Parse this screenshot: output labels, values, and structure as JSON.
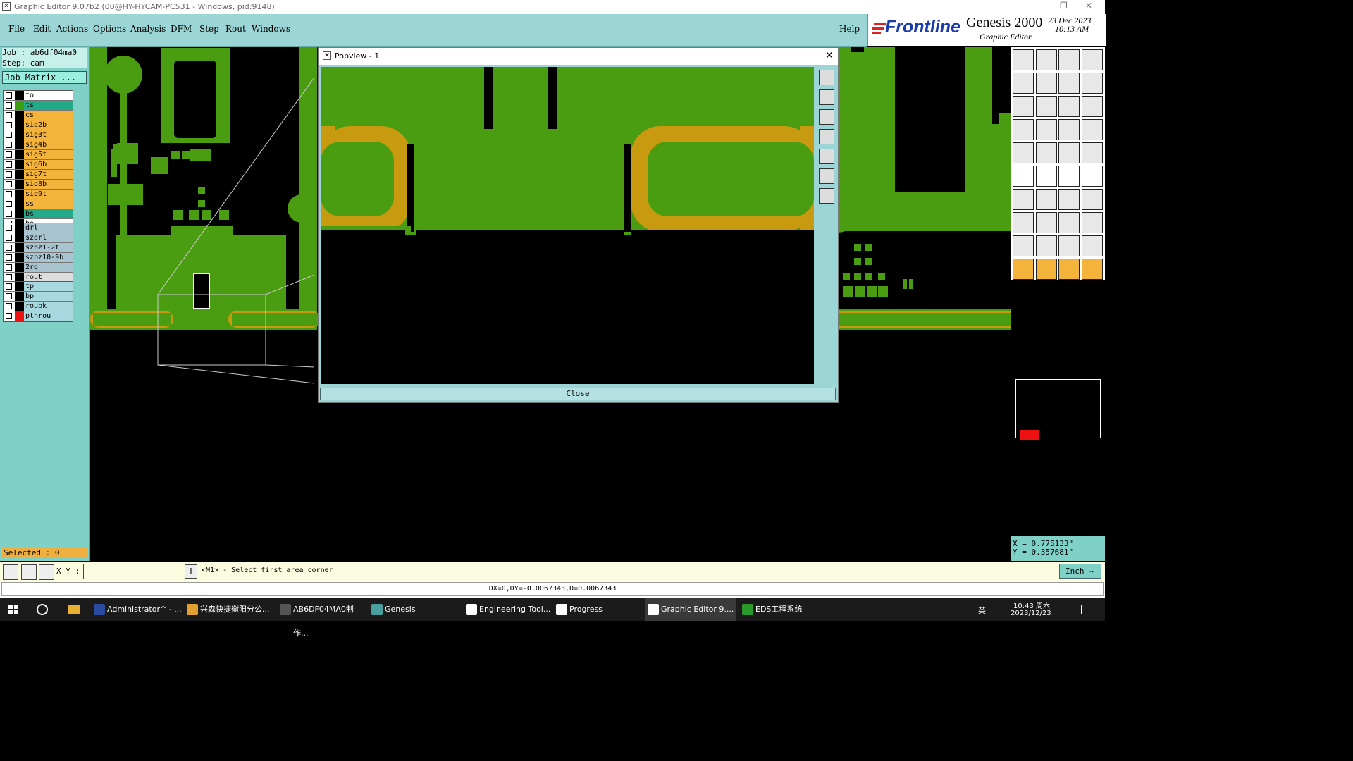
{
  "window": {
    "title": "Graphic Editor 9.07b2 (00@HY-HYCAM-PC531 - Windows, pid:9148)",
    "title_icon": "graphic-editor-icon"
  },
  "menu": {
    "items": [
      "File",
      "Edit",
      "Actions",
      "Options",
      "Analysis",
      "DFM",
      "Step",
      "Rout",
      "Windows"
    ],
    "help": "Help"
  },
  "brand": {
    "logo": "Frontline",
    "product": "Genesis 2000",
    "subtitle": "Graphic Editor",
    "date": "23 Dec 2023",
    "time": "10:13 AM"
  },
  "job": {
    "job_line": "Job : ab6df04ma0",
    "step_line": "Step: cam",
    "matrix_button": "Job Matrix ..."
  },
  "layers": {
    "group1": [
      {
        "name": "to",
        "color": "#ffffff",
        "swatch": "#000000"
      },
      {
        "name": "ts",
        "color": "#22aa88",
        "swatch": "#3aa010"
      },
      {
        "name": "cs",
        "color": "#f4b43c",
        "swatch": "#000000"
      },
      {
        "name": "sig2b",
        "color": "#f4b43c",
        "swatch": "#000000"
      },
      {
        "name": "sig3t",
        "color": "#f4b43c",
        "swatch": "#000000"
      },
      {
        "name": "sig4b",
        "color": "#f4b43c",
        "swatch": "#000000"
      },
      {
        "name": "sig5t",
        "color": "#f4b43c",
        "swatch": "#000000"
      },
      {
        "name": "sig6b",
        "color": "#f4b43c",
        "swatch": "#000000"
      },
      {
        "name": "sig7t",
        "color": "#f4b43c",
        "swatch": "#000000"
      },
      {
        "name": "sig8b",
        "color": "#f4b43c",
        "swatch": "#000000"
      },
      {
        "name": "sig9t",
        "color": "#f4b43c",
        "swatch": "#000000"
      },
      {
        "name": "ss",
        "color": "#f4b43c",
        "swatch": "#000000"
      },
      {
        "name": "bs",
        "color": "#22aa88",
        "swatch": "#000000"
      },
      {
        "name": "bo",
        "color": "#ffffff",
        "swatch": "#000000"
      }
    ],
    "group2": [
      {
        "name": "drl",
        "color": "#a8c4d0",
        "swatch": "#000000"
      },
      {
        "name": "szdrl",
        "color": "#a8c4d0",
        "swatch": "#000000"
      },
      {
        "name": "szbz1-2t",
        "color": "#a8c4d0",
        "swatch": "#000000"
      },
      {
        "name": "szbz10-9b",
        "color": "#a8c4d0",
        "swatch": "#000000"
      },
      {
        "name": "2rd",
        "color": "#a8c4d0",
        "swatch": "#000000"
      },
      {
        "name": "rout",
        "color": "#dddddd",
        "swatch": "#000000"
      }
    ],
    "group3": [
      {
        "name": "tp",
        "color": "#a8d8e0",
        "swatch": "#000000"
      },
      {
        "name": "bp",
        "color": "#a8d8e0",
        "swatch": "#000000"
      },
      {
        "name": "roubk",
        "color": "#a8d8e0",
        "swatch": "#000000"
      },
      {
        "name": "pthrou",
        "color": "#a8d8e0",
        "swatch": "#ee1111"
      }
    ]
  },
  "selected": "Selected : 0",
  "popup": {
    "title": "Popview - 1",
    "close_label": "Close",
    "close_icon": "close-x-icon"
  },
  "coords": {
    "x": "X = 0.775133\"",
    "y": "Y = 0.357681\""
  },
  "command": {
    "xy_label": "X Y :",
    "input_value": "",
    "prompt": "<M1> - Select first area corner",
    "units": "Inch"
  },
  "status": {
    "text": "DX=0,DY=-0.0067343,D=0.0067343"
  },
  "taskbar": {
    "items": [
      {
        "label": "Administrator^ - ...",
        "color": "#2a4ba0"
      },
      {
        "label": "兴森快捷衡阳分公...",
        "color": "#e0a030"
      },
      {
        "label": "AB6DF04MA0制作...",
        "color": "#555555"
      },
      {
        "label": "Genesis",
        "color": "#4aa0a0"
      },
      {
        "label": "Engineering Tool...",
        "color": "#ffffff"
      },
      {
        "label": "Progress",
        "color": "#ffffff"
      },
      {
        "label": "Graphic Editor 9....",
        "color": "#ffffff"
      },
      {
        "label": "EDS工程系统",
        "color": "#2a9a2a"
      }
    ],
    "clock_time": "10:43 周六",
    "clock_date": "2023/12/23",
    "ime": "英"
  },
  "colors": {
    "pcb_green": "#4a9c10",
    "trace_gold": "#c89a10",
    "panel": "#7fd1c8",
    "menubar": "#9bd5d5"
  }
}
